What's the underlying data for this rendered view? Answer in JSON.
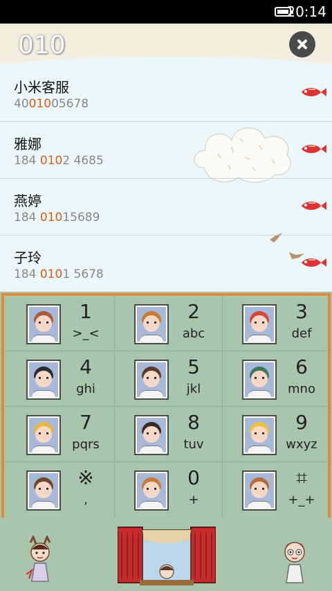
{
  "status_bar": {
    "time": "20:14"
  },
  "search": {
    "query": "010"
  },
  "results": [
    {
      "name": "小米客服",
      "number_pre": "40",
      "number_match": "010",
      "number_post": "05678"
    },
    {
      "name": "雅娜",
      "number_pre": "184 ",
      "number_match": "010",
      "number_post": "2 4685"
    },
    {
      "name": "燕婷",
      "number_pre": "184 ",
      "number_match": "010",
      "number_post": "15689"
    },
    {
      "name": "子玲",
      "number_pre": "184 ",
      "number_match": "010",
      "number_post": "1 5678"
    }
  ],
  "keys": [
    {
      "digit": "1",
      "letters": ">_<",
      "hair": "#a85a3a"
    },
    {
      "digit": "2",
      "letters": "abc",
      "hair": "#c87a2a"
    },
    {
      "digit": "3",
      "letters": "def",
      "hair": "#d8443a"
    },
    {
      "digit": "4",
      "letters": "ghi",
      "hair": "#2a2a2a"
    },
    {
      "digit": "5",
      "letters": "jkl",
      "hair": "#5a3a2a"
    },
    {
      "digit": "6",
      "letters": "mno",
      "hair": "#3a7a5a"
    },
    {
      "digit": "7",
      "letters": "pqrs",
      "hair": "#e8b83a"
    },
    {
      "digit": "8",
      "letters": "tuv",
      "hair": "#3a2a2a"
    },
    {
      "digit": "9",
      "letters": "wxyz",
      "hair": "#f0c23a"
    },
    {
      "digit": "※",
      "letters": ",",
      "hair": "#6a4a2a"
    },
    {
      "digit": "0",
      "letters": "+",
      "hair": "#c87a3a"
    },
    {
      "digit": "⌗",
      "letters": "+_+",
      "hair": "#b86a3a"
    }
  ],
  "colors": {
    "match_highlight": "#e05a14",
    "frame": "#e08a3c",
    "dialpad_bg": "#a9c5ab"
  },
  "icons": {
    "clear": "close-icon",
    "call": "window-call-icon",
    "fish": "fish-icon"
  }
}
